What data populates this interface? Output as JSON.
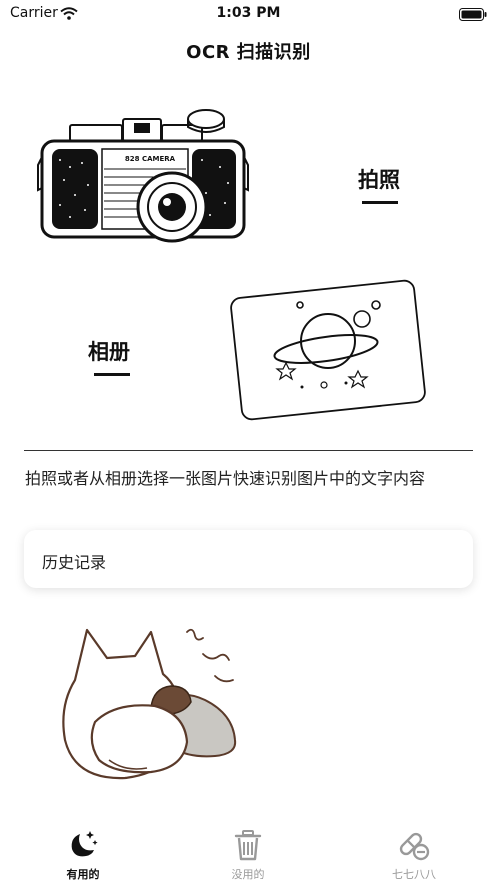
{
  "status_bar": {
    "carrier": "Carrier",
    "time": "1:03 PM"
  },
  "nav": {
    "title": "OCR 扫描识别"
  },
  "actions": {
    "photo_label": "拍照",
    "album_label": "相册",
    "camera_brand": "828 CAMERA"
  },
  "description": "拍照或者从相册选择一张图片快速识别图片中的文字内容",
  "history": {
    "label": "历史记录"
  },
  "tabs": [
    {
      "label": "有用的",
      "icon": "moon-stars-icon",
      "active": true
    },
    {
      "label": "没用的",
      "icon": "trash-icon",
      "active": false
    },
    {
      "label": "七七八八",
      "icon": "pill-icon",
      "active": false
    }
  ],
  "colors": {
    "active": "#111111",
    "inactive": "#999999",
    "accent": "#111111"
  }
}
